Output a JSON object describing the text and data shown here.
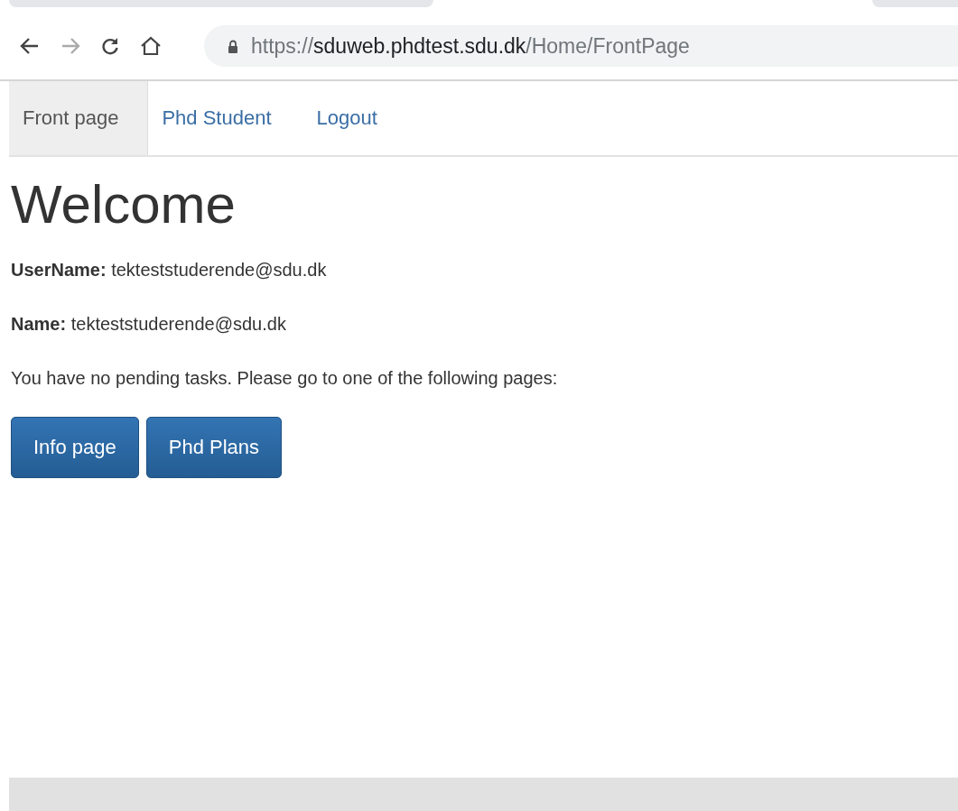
{
  "browser": {
    "url": {
      "scheme": "https://",
      "host": "sduweb.phdtest.sdu.dk",
      "path": "/Home/FrontPage"
    }
  },
  "nav": [
    {
      "label": "Front page",
      "selected": true
    },
    {
      "label": "Phd Student",
      "selected": false
    },
    {
      "label": "Logout",
      "selected": false
    }
  ],
  "heading": "Welcome",
  "fields": [
    {
      "label": "UserName:",
      "value": "tekteststuderende@sdu.dk"
    },
    {
      "label": "Name:",
      "value": "tekteststuderende@sdu.dk"
    }
  ],
  "message": "You have no pending tasks. Please go to one of the following pages:",
  "buttons": [
    "Info page",
    "Phd Plans"
  ]
}
